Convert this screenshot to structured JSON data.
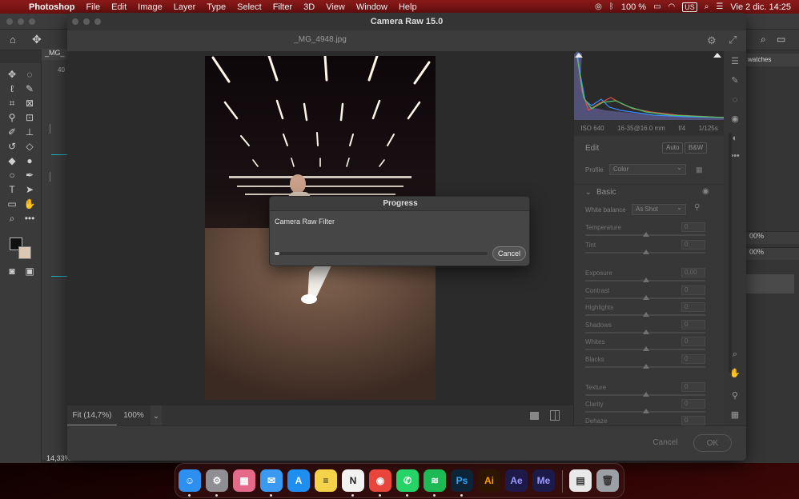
{
  "menubar": {
    "app": "Photoshop",
    "menus": [
      "File",
      "Edit",
      "Image",
      "Layer",
      "Type",
      "Select",
      "Filter",
      "3D",
      "View",
      "Window",
      "Help"
    ],
    "battery": "100 %",
    "input_source": "US",
    "clock": "Vie 2 dic.  14:25"
  },
  "photoshop": {
    "doc_tab": "_MG_",
    "ruler_tick": "40",
    "zoom_readout": "14,33%",
    "swatches_tab": "watches",
    "opacity_1": "00%",
    "opacity_2": "00%"
  },
  "camera_raw": {
    "window_title": "Camera Raw 15.0",
    "filename": "_MG_4948.jpg",
    "fit_label": "Fit (14,7%)",
    "zoom_label": "100%",
    "cancel_label": "Cancel",
    "ok_label": "OK",
    "meta": {
      "iso": "ISO 640",
      "lens": "16-35@16.0 mm",
      "aperture": "f/4",
      "shutter": "1/125s"
    },
    "edit": {
      "title": "Edit",
      "auto_label": "Auto",
      "bw_label": "B&W",
      "profile_label": "Profile",
      "profile_value": "Color",
      "basic_title": "Basic",
      "wb_label": "White balance",
      "wb_value": "As Shot",
      "sliders": [
        {
          "label": "Temperature",
          "value": "0"
        },
        {
          "label": "Tint",
          "value": "0"
        },
        {
          "label": "Exposure",
          "value": "0,00"
        },
        {
          "label": "Contrast",
          "value": "0"
        },
        {
          "label": "Highlights",
          "value": "0"
        },
        {
          "label": "Shadows",
          "value": "0"
        },
        {
          "label": "Whites",
          "value": "0"
        },
        {
          "label": "Blacks",
          "value": "0"
        },
        {
          "label": "Texture",
          "value": "0"
        },
        {
          "label": "Clarity",
          "value": "0"
        },
        {
          "label": "Dehaze",
          "value": "0"
        }
      ]
    }
  },
  "progress_dialog": {
    "title": "Progress",
    "task": "Camera Raw Filter",
    "progress_fraction": 0.02,
    "cancel_label": "Cancel"
  },
  "dock": {
    "apps": [
      {
        "name": "finder-icon",
        "glyph": "☺",
        "color": "#2d8ff0"
      },
      {
        "name": "system-preferences-icon",
        "glyph": "⚙",
        "color": "#8e8e93"
      },
      {
        "name": "launchpad-icon",
        "glyph": "▦",
        "color": "#e56a8a"
      },
      {
        "name": "mail-icon",
        "glyph": "✉",
        "color": "#3a9af2"
      },
      {
        "name": "app-store-icon",
        "glyph": "A",
        "color": "#1f8ef1"
      },
      {
        "name": "notes-icon",
        "glyph": "≡",
        "color": "#f4d34b"
      },
      {
        "name": "notion-icon",
        "glyph": "N",
        "color": "#f2f2f2"
      },
      {
        "name": "chrome-icon",
        "glyph": "◉",
        "color": "#e8453c"
      },
      {
        "name": "whatsapp-icon",
        "glyph": "✆",
        "color": "#25d366"
      },
      {
        "name": "spotify-icon",
        "glyph": "≋",
        "color": "#1db954"
      },
      {
        "name": "photoshop-icon",
        "glyph": "Ps",
        "color": "#0d2436"
      },
      {
        "name": "illustrator-icon",
        "glyph": "Ai",
        "color": "#2c1602"
      },
      {
        "name": "after-effects-icon",
        "glyph": "Ae",
        "color": "#1d1a4a"
      },
      {
        "name": "media-encoder-icon",
        "glyph": "Me",
        "color": "#1b1a48"
      }
    ],
    "extra": [
      {
        "name": "recent-document-icon",
        "color": "#e9e9e9"
      },
      {
        "name": "trash-icon",
        "color": "#9aa0a6"
      }
    ]
  }
}
